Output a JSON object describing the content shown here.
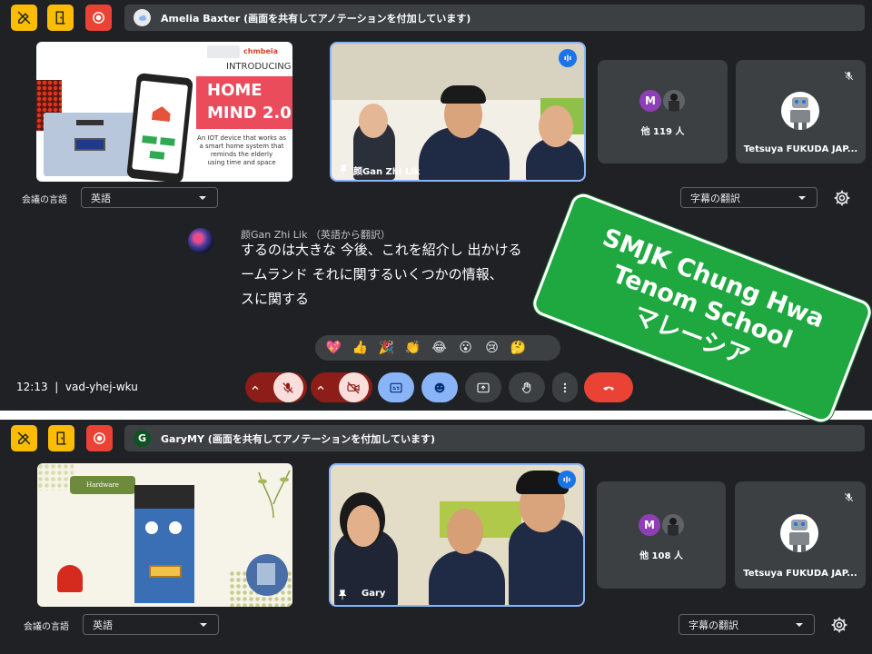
{
  "top": {
    "presenter_text": "Amelia Baxter (画面を共有してアノテーションを付加しています)",
    "slide": {
      "introducing": "INTRODUCING",
      "title_line1": "HOME",
      "title_line2": "MIND 2.0",
      "brand": "chmbeia",
      "desc_line1": "An IOT device that works as",
      "desc_line2": "a smart home system that",
      "desc_line3": "reminds the elderly",
      "desc_line4": "using time and space"
    },
    "main_tile_name": "颜Gan Zhi Lik",
    "others_initial": "M",
    "others_label": "他 119 人",
    "robot_tile_name": "Tetsuya FUKUDA JAP...",
    "lang_label": "会議の言語",
    "lang_value": "英語",
    "translate_value": "字幕の翻訳",
    "caption": {
      "speaker": "颜Gan Zhi Lik （英語から翻訳）",
      "line1": "するのは大きな 今後、これを紹介し 出かける",
      "line2": "ームランド それに関するいくつかの情報、",
      "line3": "スに関する"
    },
    "reactions": [
      "💖",
      "👍",
      "🎉",
      "👏",
      "😂",
      "😮",
      "😢",
      "🤔"
    ],
    "time": "12:13",
    "meeting_code": "vad-yhej-wku"
  },
  "bottom": {
    "presenter_initial": "G",
    "presenter_text": "GaryMY (画面を共有してアノテーションを付加しています)",
    "slide_label": "Hardware",
    "main_tile_name": "Gary",
    "others_initial": "M",
    "others_label": "他 108 人",
    "robot_tile_name": "Tetsuya FUKUDA JAP...",
    "lang_label": "会議の言語",
    "lang_value": "英語",
    "translate_value": "字幕の翻訳"
  },
  "badge": {
    "line1": "SMJK Chung Hwa",
    "line2": "Tenom School",
    "line3": "マレーシア"
  },
  "colors": {
    "background": "#202124",
    "tile": "#3c4043",
    "accent": "#8ab4f8",
    "tool_yellow": "#fbbc04",
    "record_red": "#ea4335",
    "badge_green": "#1fa840"
  }
}
